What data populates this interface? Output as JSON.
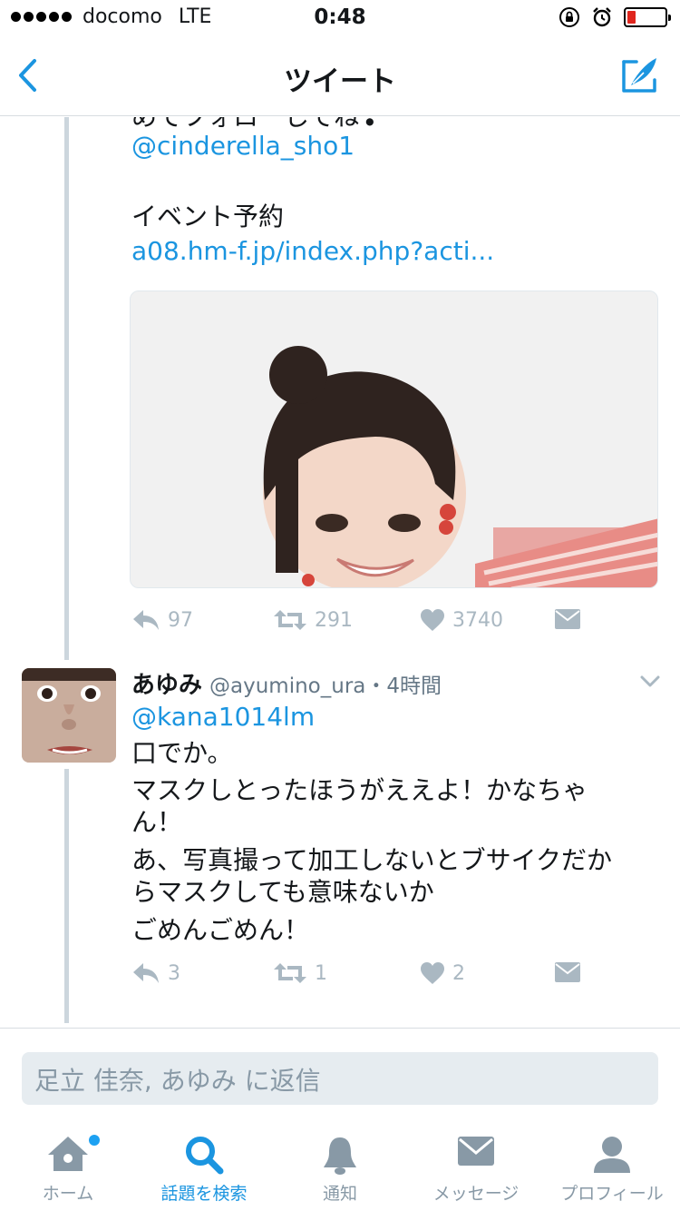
{
  "status_bar": {
    "carrier": "docomo",
    "network": "LTE",
    "time": "0:48"
  },
  "nav": {
    "title": "ツイート"
  },
  "tweet1": {
    "cut_text": "めでフォローしてね❣",
    "mention": "@cinderella_sho1",
    "event_label": "イベント予約",
    "link": "a08.hm-f.jp/index.php?acti...",
    "reply_count": "97",
    "retweet_count": "291",
    "like_count": "3740"
  },
  "tweet2": {
    "name": "あゆみ",
    "handle": "@ayumino_ura",
    "time": "・4時間",
    "mention": "@kana1014lm",
    "lines": [
      "口でか。",
      "マスクしとったほうがええよ！かなちゃ",
      "ん！",
      "あ、写真撮って加工しないとブサイクだか",
      "らマスクしても意味ないか",
      "ごめんごめん！"
    ],
    "reply_count": "3",
    "retweet_count": "1",
    "like_count": "2"
  },
  "reply": {
    "placeholder": "足立 佳奈, あゆみ に返信"
  },
  "tabs": [
    {
      "label": "ホーム",
      "icon": "home-icon",
      "active": false
    },
    {
      "label": "話題を検索",
      "icon": "search-icon",
      "active": true
    },
    {
      "label": "通知",
      "icon": "bell-icon",
      "active": false
    },
    {
      "label": "メッセージ",
      "icon": "mail-icon",
      "active": false
    },
    {
      "label": "プロフィール",
      "icon": "person-icon",
      "active": false
    }
  ],
  "colors": {
    "accent": "#1b95e0",
    "icon_gray": "#aab8c2",
    "battery_low": "#e0261e"
  }
}
